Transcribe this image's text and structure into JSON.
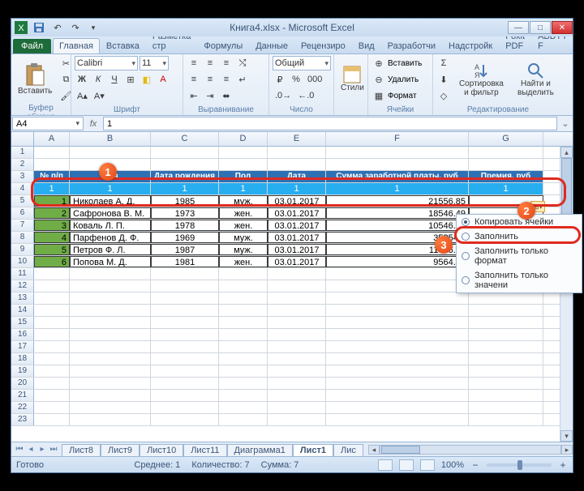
{
  "window": {
    "title": "Книга4.xlsx - Microsoft Excel"
  },
  "tabs": {
    "file": "Файл",
    "items": [
      "Главная",
      "Вставка",
      "Разметка стр",
      "Формулы",
      "Данные",
      "Рецензиро",
      "Вид",
      "Разработчи",
      "Надстройк",
      "Foxit PDF",
      "ABBYY F"
    ],
    "active_index": 0
  },
  "ribbon": {
    "clipboard": {
      "paste": "Вставить",
      "label": "Буфер обмена"
    },
    "font": {
      "name": "Calibri",
      "size": "11",
      "label": "Шрифт"
    },
    "alignment": {
      "label": "Выравнивание"
    },
    "number": {
      "format": "Общий",
      "label": "Число"
    },
    "styles": {
      "label": "Стили"
    },
    "cells": {
      "insert": "Вставить",
      "delete": "Удалить",
      "format": "Формат",
      "label": "Ячейки"
    },
    "editing": {
      "sort": "Сортировка и фильтр",
      "find": "Найти и выделить",
      "label": "Редактирование"
    }
  },
  "name_box": "A4",
  "formula_bar": "1",
  "columns": [
    "A",
    "B",
    "C",
    "D",
    "E",
    "F",
    "G"
  ],
  "header_row_num": 3,
  "headers": [
    "№ п/п",
    "Имя",
    "Дата рождения",
    "Пол",
    "Дата",
    "Сумма заработной платы, руб",
    "Премия, руб"
  ],
  "selected_row_num": 4,
  "selected_values": [
    "1",
    "1",
    "1",
    "1",
    "1",
    "1",
    "1"
  ],
  "data": [
    {
      "n": 5,
      "num": "1",
      "name": "Николаев А. Д.",
      "birth": "1985",
      "sex": "муж.",
      "date": "03.01.2017",
      "salary": "21556.85"
    },
    {
      "n": 6,
      "num": "2",
      "name": "Сафронова В. М.",
      "birth": "1973",
      "sex": "жен.",
      "date": "03.01.2017",
      "salary": "18546.49"
    },
    {
      "n": 7,
      "num": "3",
      "name": "Коваль Л. П.",
      "birth": "1978",
      "sex": "жен.",
      "date": "03.01.2017",
      "salary": "10546.26"
    },
    {
      "n": 8,
      "num": "4",
      "name": "Парфенов Д. Ф.",
      "birth": "1969",
      "sex": "муж.",
      "date": "03.01.2017",
      "salary": "35254.4"
    },
    {
      "n": 9,
      "num": "5",
      "name": "Петров Ф. Л.",
      "birth": "1987",
      "sex": "муж.",
      "date": "03.01.2017",
      "salary": "11456.89"
    },
    {
      "n": 10,
      "num": "6",
      "name": "Попова М. Д.",
      "birth": "1981",
      "sex": "жен.",
      "date": "03.01.2017",
      "salary": "9564.95"
    }
  ],
  "blank_rows": [
    1,
    2,
    11,
    12,
    13,
    14,
    15,
    16,
    17,
    18,
    19,
    20,
    21,
    22,
    23
  ],
  "sheets": [
    "Лист8",
    "Лист9",
    "Лист10",
    "Лист11",
    "Диаграмма1",
    "Лист1",
    "Лис"
  ],
  "active_sheet_index": 5,
  "status": {
    "ready": "Готово",
    "avg": "Среднее: 1",
    "count": "Количество: 7",
    "sum": "Сумма: 7",
    "zoom": "100%"
  },
  "context_menu": {
    "items": [
      {
        "label": "Копировать ячейки",
        "checked": true
      },
      {
        "label": "Заполнить",
        "checked": false
      },
      {
        "label": "Заполнить только формат",
        "checked": false
      },
      {
        "label": "Заполнить только значени",
        "checked": false
      }
    ]
  },
  "annotations": {
    "b1": "1",
    "b2": "2",
    "b3": "3"
  }
}
